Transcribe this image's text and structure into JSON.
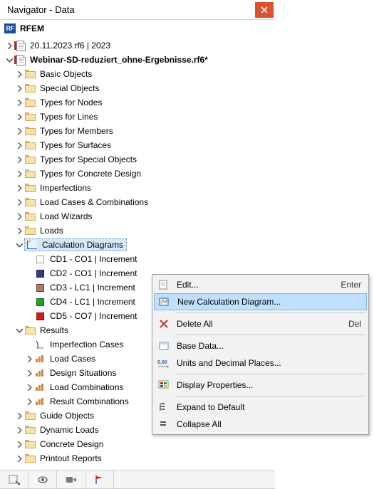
{
  "titlebar": {
    "title": "Navigator - Data"
  },
  "app": {
    "name": "RFEM"
  },
  "files": {
    "f1": {
      "name": "20.11.2023.rf6 | 2023"
    },
    "f2": {
      "name": "Webinar-SD-reduziert_ohne-Ergebnisse.rf6*"
    }
  },
  "folders": {
    "basic": "Basic Objects",
    "special": "Special Objects",
    "tnodes": "Types for Nodes",
    "tlines": "Types for Lines",
    "tmembers": "Types for Members",
    "tsurfaces": "Types for Surfaces",
    "tspecial": "Types for Special Objects",
    "tconcrete": "Types for Concrete Design",
    "imperf": "Imperfections",
    "loadcases": "Load Cases & Combinations",
    "loadwiz": "Load Wizards",
    "loads": "Loads",
    "calcdiag": "Calculation Diagrams",
    "results": "Results",
    "guide": "Guide Objects",
    "dynloads": "Dynamic Loads",
    "concdesign": "Concrete Design",
    "printout": "Printout Reports"
  },
  "diagrams": {
    "cd1": "CD1 - CO1 | Increment",
    "cd2": "CD2 - CO1 | Increment",
    "cd3": "CD3 - LC1 | Increment",
    "cd4": "CD4 - LC1 | Increment",
    "cd5": "CD5 - CO7 | Increment"
  },
  "diagram_colors": {
    "cd1": "#7de3e3",
    "cd2": "#3a3a7a",
    "cd3": "#b0736a",
    "cd4": "#1aa81a",
    "cd5": "#d81a1a"
  },
  "results_children": {
    "impcases": "Imperfection Cases",
    "lcases": "Load Cases",
    "dsit": "Design Situations",
    "lcomb": "Load Combinations",
    "rcomb": "Result Combinations"
  },
  "context_menu": {
    "edit": "Edit...",
    "edit_key": "Enter",
    "new": "New Calculation Diagram...",
    "deleteall": "Delete All",
    "delete_key": "Del",
    "basedata": "Base Data...",
    "units": "Units and Decimal Places...",
    "display": "Display Properties...",
    "expand": "Expand to Default",
    "collapse": "Collapse All"
  }
}
